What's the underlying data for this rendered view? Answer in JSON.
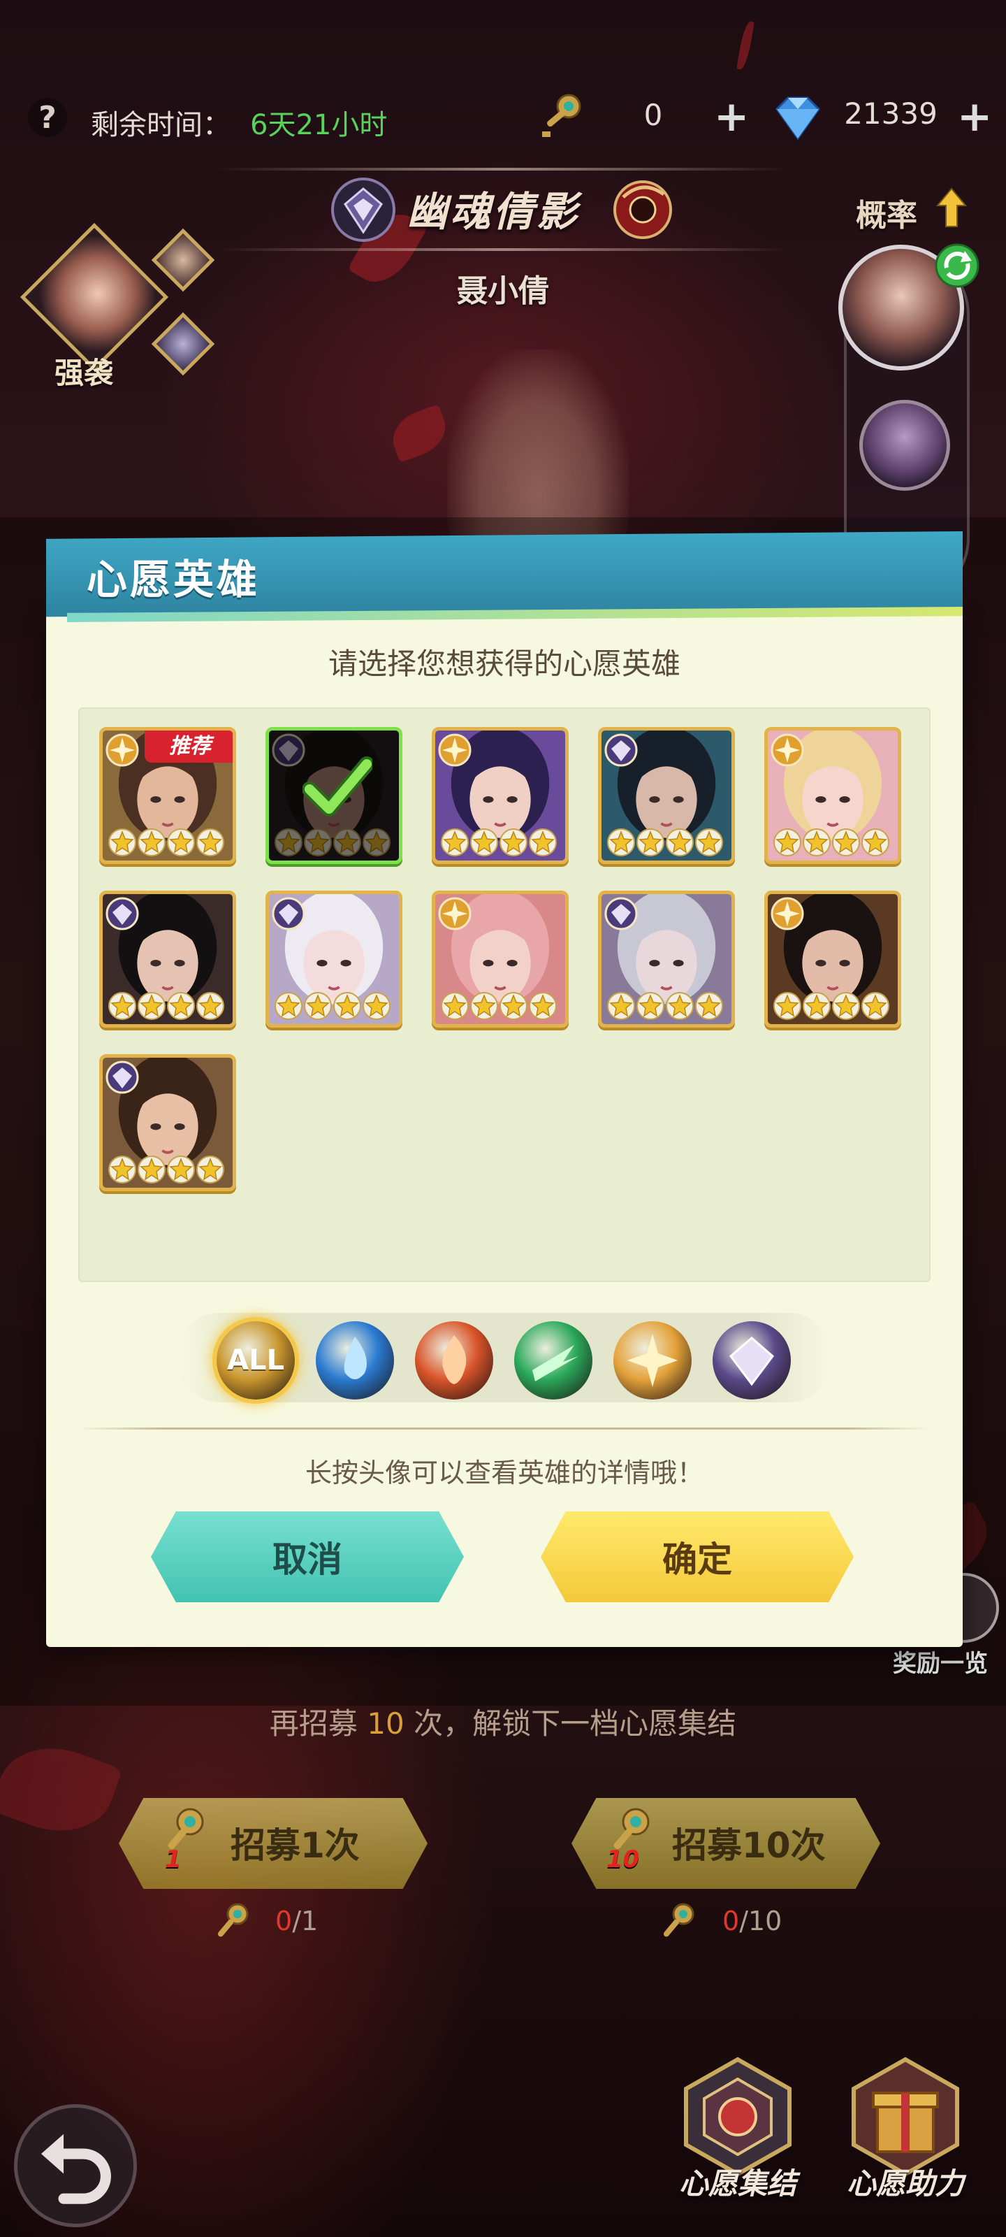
{
  "topbar": {
    "help": "?",
    "time_label": "剩余时间：",
    "time_value": "6天21小时",
    "key_count": "0",
    "gem_count": "21339",
    "plus": "+"
  },
  "banner": {
    "title": "幽魂倩影",
    "hero_name": "聂小倩"
  },
  "left": {
    "assault_label": "强袭"
  },
  "right": {
    "prob_label": "概率"
  },
  "modal": {
    "title": "心愿英雄",
    "subtitle": "请选择您想获得的心愿英雄",
    "recommend_badge": "推荐",
    "filter_all": "ALL",
    "hint": "长按头像可以查看英雄的详情哦！",
    "cancel": "取消",
    "confirm": "确定",
    "heroes": [
      {
        "faction": "light",
        "stars": 4,
        "recommended": true,
        "selected": false,
        "hair": "#4a2f22",
        "skin": "#e3b79c",
        "bg": "#8a6a3a"
      },
      {
        "faction": "shadow",
        "stars": 4,
        "recommended": false,
        "selected": true,
        "hair": "#1c1616",
        "skin": "#b58a78",
        "bg": "#2a2224"
      },
      {
        "faction": "light",
        "stars": 4,
        "recommended": false,
        "selected": false,
        "hair": "#2b2050",
        "skin": "#f0cfc4",
        "bg": "#6a4a9a"
      },
      {
        "faction": "shadow",
        "stars": 4,
        "recommended": false,
        "selected": false,
        "hair": "#17202a",
        "skin": "#d8b8a8",
        "bg": "#2d5a6a"
      },
      {
        "faction": "light",
        "stars": 4,
        "recommended": false,
        "selected": false,
        "hair": "#efd49a",
        "skin": "#f6d6cc",
        "bg": "#e8b0b8"
      },
      {
        "faction": "shadow",
        "stars": 4,
        "recommended": false,
        "selected": false,
        "hair": "#121010",
        "skin": "#e6c2b2",
        "bg": "#3a2a2a"
      },
      {
        "faction": "shadow",
        "stars": 4,
        "recommended": false,
        "selected": false,
        "hair": "#eeeaf2",
        "skin": "#f4dcdc",
        "bg": "#b8a8c8"
      },
      {
        "faction": "light",
        "stars": 4,
        "recommended": false,
        "selected": false,
        "hair": "#e8a6a8",
        "skin": "#f2d2c8",
        "bg": "#d88888"
      },
      {
        "faction": "shadow",
        "stars": 4,
        "recommended": false,
        "selected": false,
        "hair": "#c8c8d4",
        "skin": "#e8d8dc",
        "bg": "#8a7a9a"
      },
      {
        "faction": "light",
        "stars": 4,
        "recommended": false,
        "selected": false,
        "hair": "#1a1210",
        "skin": "#e2bca8",
        "bg": "#5a3a22"
      },
      {
        "faction": "shadow",
        "stars": 4,
        "recommended": false,
        "selected": false,
        "hair": "#3a2418",
        "skin": "#e6bfa4",
        "bg": "#7a5a3a"
      }
    ],
    "filters": [
      {
        "name": "all",
        "color": "#c9962e",
        "active": true
      },
      {
        "name": "water",
        "color": "#2a7ad0",
        "active": false
      },
      {
        "name": "fire",
        "color": "#d9542a",
        "active": false
      },
      {
        "name": "wind",
        "color": "#2aa85a",
        "active": false
      },
      {
        "name": "light",
        "color": "#e4a23a",
        "active": false
      },
      {
        "name": "shadow",
        "color": "#5a4a8a",
        "active": false
      }
    ]
  },
  "recruit": {
    "note_prefix": "再招募",
    "note_count": "10",
    "note_suffix": "次，解锁下一档心愿集结",
    "single_label": "招募1次",
    "single_num": "1",
    "ten_label": "招募10次",
    "ten_num": "10",
    "single_cost_have": "0",
    "single_cost_need": "/1",
    "ten_cost_have": "0",
    "ten_cost_need": "/10"
  },
  "bottom": {
    "wish_gather": "心愿集结",
    "wish_help": "心愿助力",
    "reward_list": "奖励一览"
  },
  "colors": {
    "time_green": "#58d25a",
    "header_teal": "#3fa9c6",
    "cancel_teal": "#42c3b2",
    "confirm_yellow": "#f4c93a",
    "card_gold": "#e2b34a"
  }
}
